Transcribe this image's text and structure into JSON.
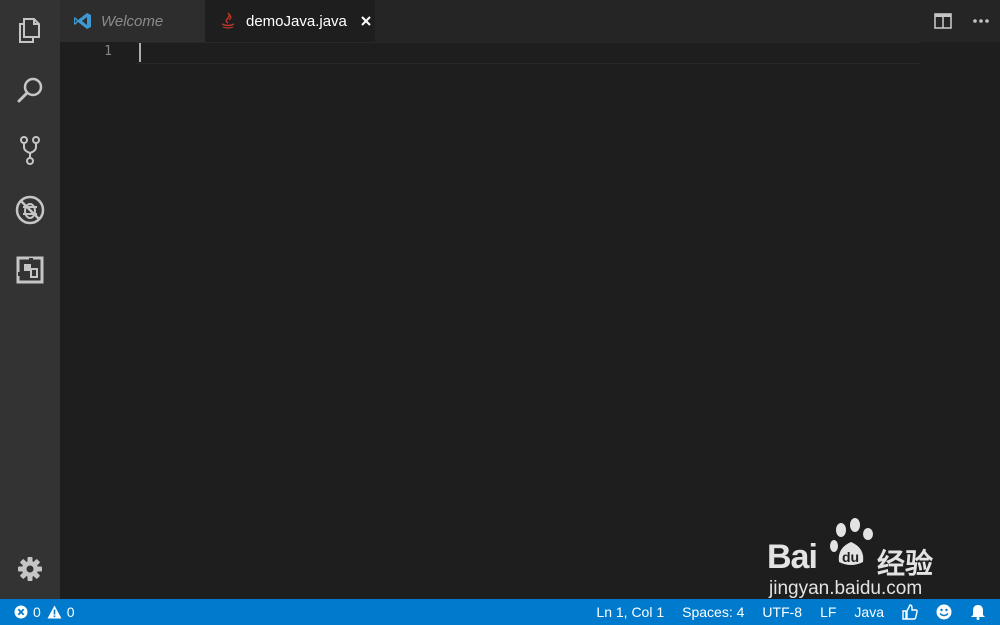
{
  "activity_bar": {
    "items": [
      {
        "icon": "explorer-files-icon"
      },
      {
        "icon": "search-icon"
      },
      {
        "icon": "source-control-icon"
      },
      {
        "icon": "debug-icon"
      },
      {
        "icon": "extensions-icon"
      }
    ],
    "bottom": {
      "icon": "gear-icon"
    }
  },
  "tabs": [
    {
      "label": "Welcome",
      "icon": "vscode-logo-icon",
      "active": false
    },
    {
      "label": "demoJava.java",
      "icon": "java-file-icon",
      "active": true
    }
  ],
  "editor": {
    "line_numbers": [
      "1"
    ],
    "content": ""
  },
  "status_bar": {
    "errors": "0",
    "warnings": "0",
    "position": "Ln 1, Col 1",
    "indentation": "Spaces: 4",
    "encoding": "UTF-8",
    "eol": "LF",
    "language": "Java"
  },
  "watermark": {
    "brand_text": "Bai",
    "brand_cn": "经验",
    "url": "jingyan.baidu.com"
  },
  "colors": {
    "activity_bar": "#333333",
    "editor_bg": "#1e1e1e",
    "tab_bar": "#252526",
    "status_bar": "#007acc",
    "icon_color": "#c5c5c5"
  }
}
